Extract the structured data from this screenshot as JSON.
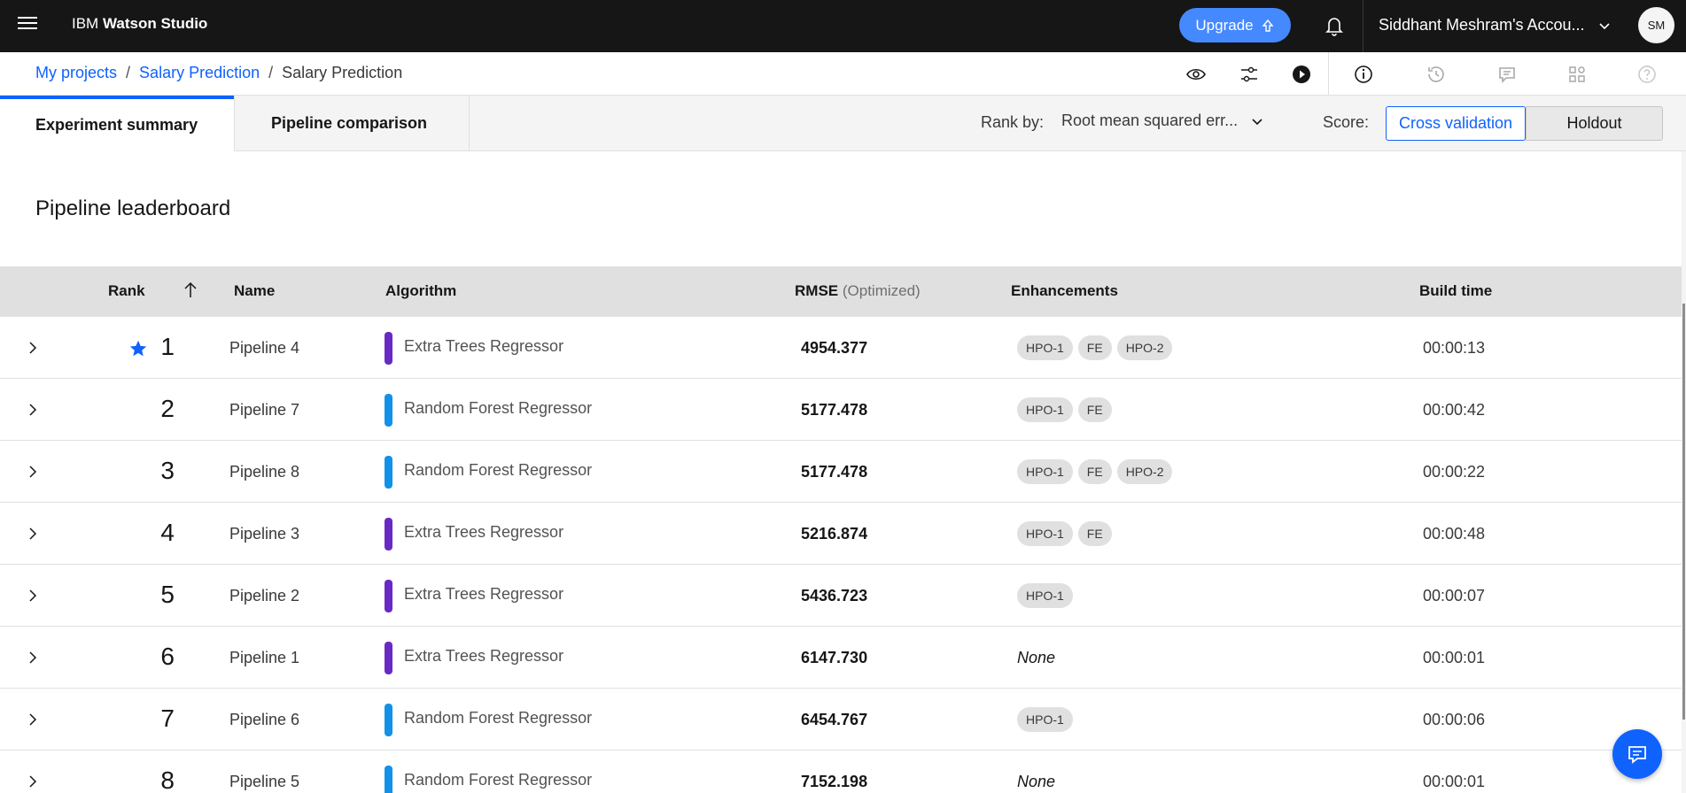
{
  "header": {
    "brand_prefix": "IBM",
    "brand_name": "Watson Studio",
    "upgrade_label": "Upgrade",
    "account_name": "Siddhant Meshram's Accou...",
    "avatar_initials": "SM"
  },
  "breadcrumb": {
    "items": [
      "My projects",
      "Salary Prediction",
      "Salary Prediction"
    ],
    "separator": "/"
  },
  "tabs": {
    "active": "Experiment summary",
    "other": "Pipeline comparison"
  },
  "rank_by": {
    "label": "Rank by:",
    "value": "Root mean squared err..."
  },
  "score": {
    "label": "Score:",
    "options": [
      "Cross validation",
      "Holdout"
    ],
    "selected": "Cross validation"
  },
  "leaderboard": {
    "title": "Pipeline leaderboard",
    "columns": {
      "rank": "Rank",
      "name": "Name",
      "algorithm": "Algorithm",
      "rmse": "RMSE",
      "rmse_note": "(Optimized)",
      "enhancements": "Enhancements",
      "build_time": "Build time"
    },
    "rows": [
      {
        "rank": "1",
        "starred": true,
        "name": "Pipeline 4",
        "algorithm": "Extra Trees Regressor",
        "algo_color": "#6929c4",
        "rmse": "4954.377",
        "enhancements": [
          "HPO-1",
          "FE",
          "HPO-2"
        ],
        "build_time": "00:00:13"
      },
      {
        "rank": "2",
        "starred": false,
        "name": "Pipeline 7",
        "algorithm": "Random Forest Regressor",
        "algo_color": "#1192e8",
        "rmse": "5177.478",
        "enhancements": [
          "HPO-1",
          "FE"
        ],
        "build_time": "00:00:42"
      },
      {
        "rank": "3",
        "starred": false,
        "name": "Pipeline 8",
        "algorithm": "Random Forest Regressor",
        "algo_color": "#1192e8",
        "rmse": "5177.478",
        "enhancements": [
          "HPO-1",
          "FE",
          "HPO-2"
        ],
        "build_time": "00:00:22"
      },
      {
        "rank": "4",
        "starred": false,
        "name": "Pipeline 3",
        "algorithm": "Extra Trees Regressor",
        "algo_color": "#6929c4",
        "rmse": "5216.874",
        "enhancements": [
          "HPO-1",
          "FE"
        ],
        "build_time": "00:00:48"
      },
      {
        "rank": "5",
        "starred": false,
        "name": "Pipeline 2",
        "algorithm": "Extra Trees Regressor",
        "algo_color": "#6929c4",
        "rmse": "5436.723",
        "enhancements": [
          "HPO-1"
        ],
        "build_time": "00:00:07"
      },
      {
        "rank": "6",
        "starred": false,
        "name": "Pipeline 1",
        "algorithm": "Extra Trees Regressor",
        "algo_color": "#6929c4",
        "rmse": "6147.730",
        "enhancements": [],
        "none_label": "None",
        "build_time": "00:00:01"
      },
      {
        "rank": "7",
        "starred": false,
        "name": "Pipeline 6",
        "algorithm": "Random Forest Regressor",
        "algo_color": "#1192e8",
        "rmse": "6454.767",
        "enhancements": [
          "HPO-1"
        ],
        "build_time": "00:00:06"
      },
      {
        "rank": "8",
        "starred": false,
        "name": "Pipeline 5",
        "algorithm": "Random Forest Regressor",
        "algo_color": "#1192e8",
        "rmse": "7152.198",
        "enhancements": [],
        "none_label": "None",
        "build_time": "00:00:01"
      }
    ]
  },
  "colors": {
    "accent": "#0f62fe",
    "topbar": "#161616",
    "upgrade": "#4589ff",
    "star": "#0f62fe"
  },
  "icons": [
    "menu-icon",
    "upgrade-icon",
    "notification-icon",
    "chevron-down-icon",
    "view-icon",
    "settings-adjust-icon",
    "run-icon",
    "information-icon",
    "history-icon",
    "comment-icon",
    "apps-icon",
    "help-icon",
    "arrow-up-icon",
    "chevron-right-icon",
    "star-icon",
    "chat-icon"
  ]
}
